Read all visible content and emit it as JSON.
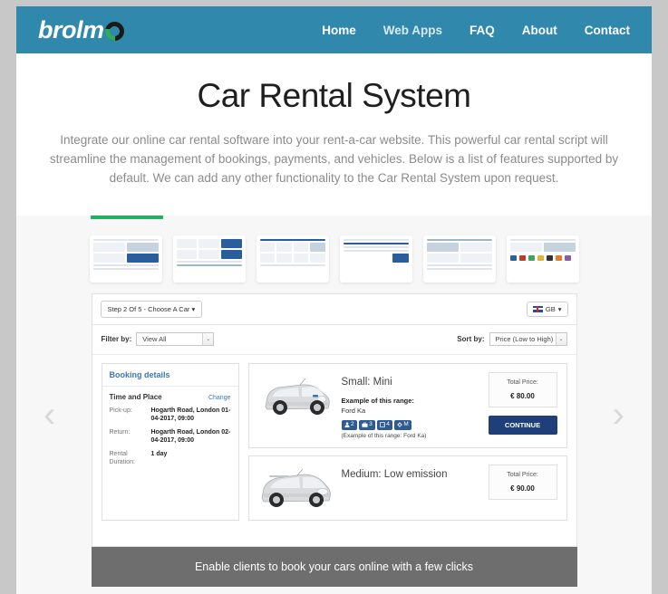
{
  "header": {
    "logo_text": "brolm",
    "nav": [
      {
        "label": "Home",
        "muted": false
      },
      {
        "label": "Web Apps",
        "muted": true
      },
      {
        "label": "FAQ",
        "muted": false
      },
      {
        "label": "About",
        "muted": false
      },
      {
        "label": "Contact",
        "muted": false
      }
    ]
  },
  "hero": {
    "title": "Car Rental System",
    "description": "Integrate our online car rental software into your rent-a-car website. This powerful car rental script will streamline the management of bookings, payments, and vehicles. Below is a list of features supported by default. We can add any other functionality to the Car Rental System upon request."
  },
  "gallery": {
    "accent_color": "#27ae60",
    "thumbnail_count": 6,
    "prev_arrow": "‹",
    "next_arrow": "›",
    "caption": "Enable clients to book your cars online with a few clicks"
  },
  "screenshot": {
    "step_selector": "Step 2 Of 5 - Choose A Car",
    "step_caret": "▾",
    "locale": "GB",
    "locale_caret": "▾",
    "filter_label": "Filter by:",
    "filter_value": "View All",
    "sort_label": "Sort by:",
    "sort_value": "Price (Low to High)",
    "select_caret": "⌄",
    "booking": {
      "panel_title": "Booking details",
      "section_title": "Time and Place",
      "change_link": "Change",
      "rows": [
        {
          "key": "Pick-up:",
          "value": "Hogarth Road, London 01-04-2017, 09:00"
        },
        {
          "key": "Return:",
          "value": "Hogarth Road, London 02-04-2017, 09:00"
        },
        {
          "key": "Rental Duration:",
          "value": "1 day"
        }
      ]
    },
    "cars": [
      {
        "title": "Small: Mini",
        "example_label": "Example of this range:",
        "example_value": "Ford Ka",
        "badges": [
          {
            "icon": "person-icon",
            "value": "2"
          },
          {
            "icon": "suitcase-icon",
            "value": "3"
          },
          {
            "icon": "door-icon",
            "value": "4"
          },
          {
            "icon": "gear-icon",
            "value": "M"
          }
        ],
        "note": "(Example of this range: Ford Ka)",
        "price_label": "Total Price:",
        "price_value": "€ 80.00",
        "continue_label": "CONTINUE"
      },
      {
        "title": "Medium: Low emission",
        "price_label": "Total Price:",
        "price_value": "€ 90.00"
      }
    ]
  }
}
